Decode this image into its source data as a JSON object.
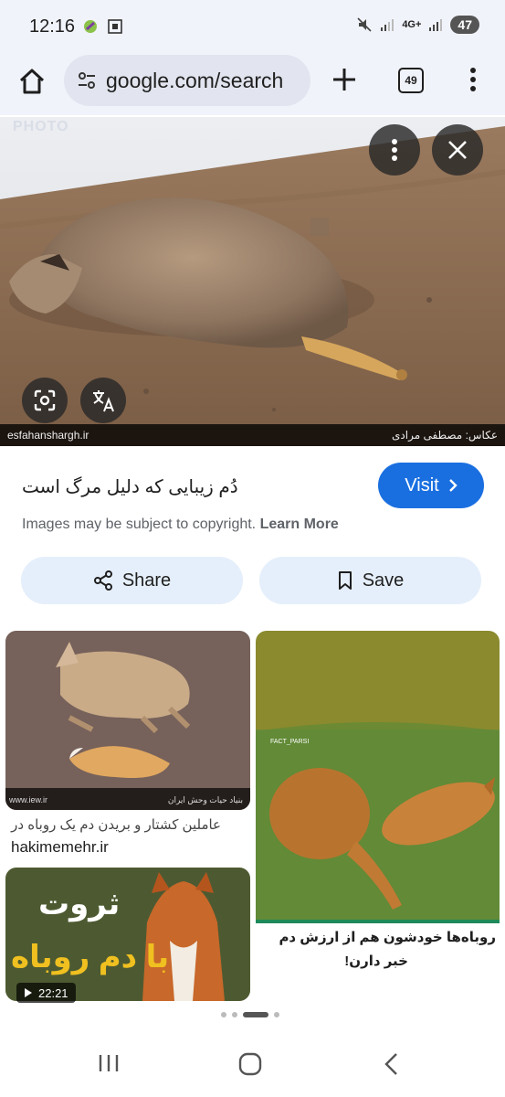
{
  "status_bar": {
    "time": "12:16",
    "network": "4G+",
    "battery": "47"
  },
  "toolbar": {
    "url": "google.com/search",
    "tab_count": "49"
  },
  "image_viewer": {
    "watermark_tag": "PHOTO",
    "caption_left": "esfahanshargh.ir",
    "caption_right": "عکاس: مصطفی مرادی",
    "title": "دُم زیبایی که دلیل مرگ است",
    "visit_label": "Visit",
    "copyright_text": "Images may be subject to copyright.",
    "learn_more": "Learn More",
    "share_label": "Share",
    "save_label": "Save"
  },
  "related": [
    {
      "caption": "عاملین کشتار و بریدن دم یک روباه در",
      "site": "hakimemehr.ir",
      "overlay_left": "www.iew.ir",
      "overlay_right": "بنیاد حیات وحش ایران"
    },
    {
      "overlay_top": "FACT_PARSI",
      "headline_line1": "روباه‌ها خودشون هم از ارزش دم",
      "headline_line2": "خبر دارن!"
    },
    {
      "thumb_text_line1": "ثروت",
      "thumb_text_line2": "با دم روباه",
      "duration": "22:21"
    }
  ]
}
